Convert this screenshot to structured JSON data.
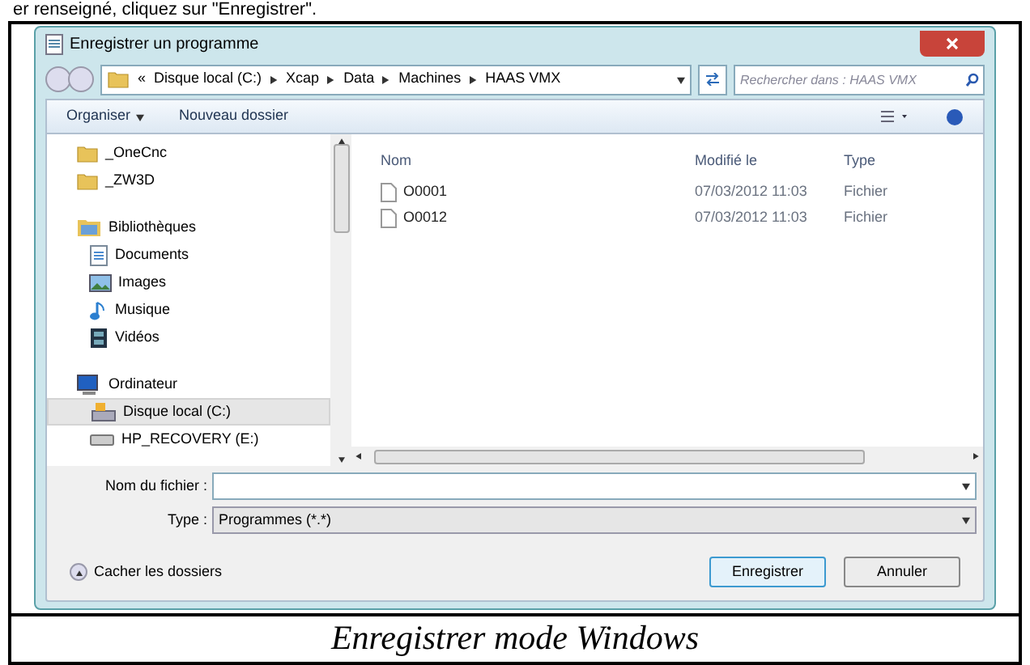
{
  "page_text": "er renseigné, cliquez sur \"Enregistrer\".",
  "window": {
    "title": "Enregistrer un programme"
  },
  "address_bar": {
    "path": [
      "«",
      "Disque local (C:)",
      "Xcap",
      "Data",
      "Machines",
      "HAAS VMX"
    ]
  },
  "search": {
    "placeholder": "Rechercher dans : HAAS VMX"
  },
  "toolbar": {
    "buttons": [
      "Organiser",
      "Nouveau dossier"
    ]
  },
  "sidebar": {
    "items": [
      {
        "label": "_OneCnc",
        "kind": "folder",
        "selected": false
      },
      {
        "label": "_ZW3D",
        "kind": "folder",
        "selected": false
      },
      {
        "label": "Bibliothèques",
        "kind": "library",
        "selected": false
      },
      {
        "label": "Documents",
        "kind": "document",
        "selected": false
      },
      {
        "label": "Images",
        "kind": "image",
        "selected": false
      },
      {
        "label": "Musique",
        "kind": "music",
        "selected": false
      },
      {
        "label": "Vidéos",
        "kind": "video",
        "selected": false
      },
      {
        "label": "Ordinateur",
        "kind": "computer",
        "selected": false
      },
      {
        "label": "Disque local (C:)",
        "kind": "drive",
        "selected": true
      },
      {
        "label": "HP_RECOVERY (E:)",
        "kind": "drive2",
        "selected": false
      }
    ]
  },
  "file_list": {
    "columns": [
      "Nom",
      "Modifié le",
      "Type"
    ],
    "rows": [
      [
        "O0001",
        "07/03/2012 11:03",
        "Fichier"
      ],
      [
        "O0012",
        "07/03/2012 11:03",
        "Fichier"
      ]
    ]
  },
  "filename": {
    "label": "Nom du fichier :"
  },
  "type": {
    "label": "Type :",
    "value": "Programmes (*.*)"
  },
  "hide_folders": "Cacher les dossiers",
  "buttons": [
    "Enregistrer",
    "Annuler"
  ],
  "caption": "Enregistrer mode Windows"
}
